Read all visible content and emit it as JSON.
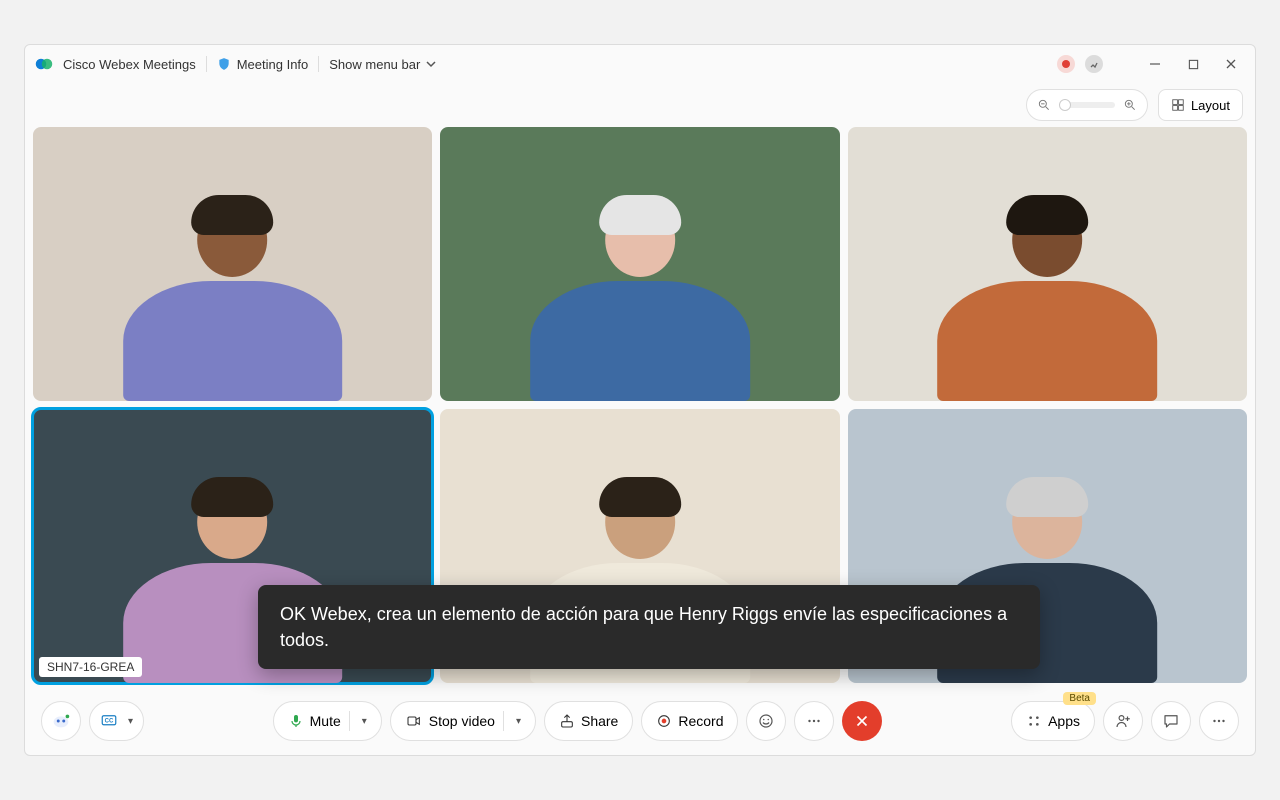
{
  "titlebar": {
    "app_name": "Cisco Webex Meetings",
    "meeting_info": "Meeting Info",
    "show_menu": "Show menu bar"
  },
  "subbar": {
    "layout_label": "Layout"
  },
  "tiles": [
    {
      "bg": "#d8cfc4",
      "shirt": "#7b7fc4",
      "skin": "#8a5a3a",
      "hair": "#2b2218",
      "label": ""
    },
    {
      "bg": "#5a7a5a",
      "shirt": "#3d6aa3",
      "skin": "#e7beab",
      "hair": "#e5e5e5",
      "label": ""
    },
    {
      "bg": "#e2ded5",
      "shirt": "#c26a3a",
      "skin": "#7a4c2f",
      "hair": "#1e1710",
      "label": ""
    },
    {
      "bg": "#3a4a52",
      "shirt": "#b88fbf",
      "skin": "#d9a98a",
      "hair": "#2b2218",
      "label": "SHN7-16-GREA",
      "active": true
    },
    {
      "bg": "#e8e0d2",
      "shirt": "#efe9db",
      "skin": "#caa07d",
      "hair": "#2b2218",
      "label": ""
    },
    {
      "bg": "#b9c5cf",
      "shirt": "#2b3a4a",
      "skin": "#dcb49c",
      "hair": "#cfcfcf",
      "label": ""
    }
  ],
  "caption_text": "OK Webex, crea un elemento de acción para que Henry Riggs envíe las especificaciones a todos.",
  "bottombar": {
    "mute": "Mute",
    "stop_video": "Stop video",
    "share": "Share",
    "record": "Record",
    "apps": "Apps",
    "beta": "Beta"
  },
  "colors": {
    "accent": "#00a0e0",
    "mic_green": "#2fa84f",
    "record_red": "#e33e2b"
  }
}
